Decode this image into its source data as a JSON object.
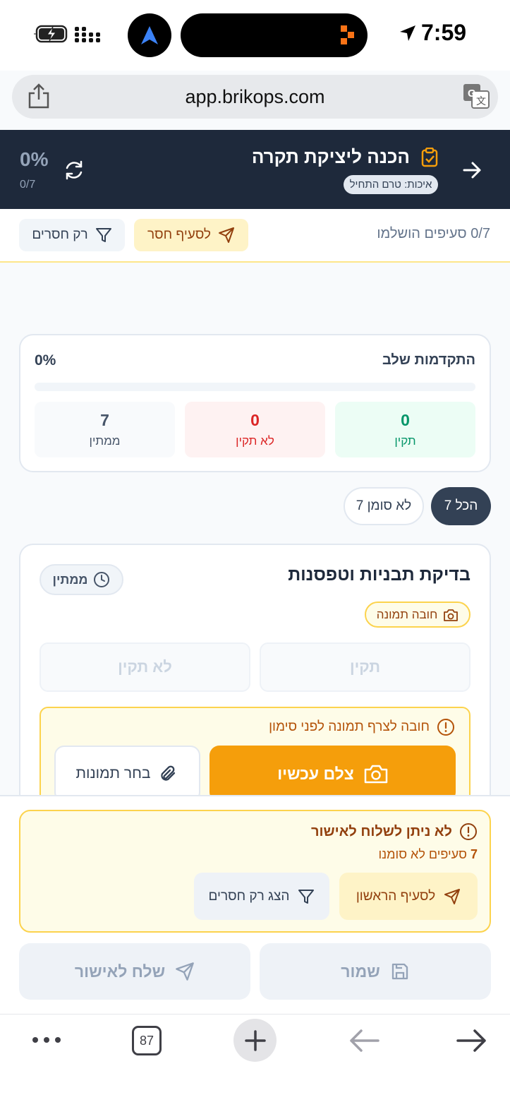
{
  "status_bar": {
    "time": "7:59"
  },
  "browser": {
    "url": "app.brikops.com",
    "tab_count": "87"
  },
  "header": {
    "title": "הכנה ליציקת תקרה",
    "badge": "איכות: טרם התחיל",
    "percent": "0%",
    "count": "0/7"
  },
  "toolbar": {
    "sections_done": "0/7 סעיפים הושלמו",
    "goto_missing_label": "לסעיף חסר",
    "only_missing_label": "רק חסרים"
  },
  "progress": {
    "title": "התקדמות שלב",
    "percent": "0%",
    "fill_fraction": 0,
    "stats": {
      "ok": {
        "value": "0",
        "label": "תקין"
      },
      "not_ok": {
        "value": "0",
        "label": "לא תקין"
      },
      "pending": {
        "value": "7",
        "label": "ממתין"
      }
    }
  },
  "filters": {
    "all": "הכל 7",
    "unmarked": "לא סומן 7"
  },
  "item": {
    "title": "בדיקת תבניות וטפסנות",
    "status": "ממתין",
    "photo_required": "חובה תמונה",
    "ok_label": "תקין",
    "not_ok_label": "לא תקין",
    "warning": "חובה לצרף תמונה לפני סימון",
    "camera_label": "צלם עכשיו",
    "pick_label": "בחר תמונות"
  },
  "bottom": {
    "cant_send_title": "לא ניתן לשלוח לאישור",
    "unmarked_count": "7",
    "unmarked_text": "סעיפים לא סומנו",
    "first_section_label": "לסעיף הראשון",
    "show_missing_label": "הצג רק חסרים",
    "save_label": "שמור",
    "send_label": "שלח לאישור"
  },
  "colors": {
    "header_bg": "#1e293b",
    "accent_amber": "#f59e0b",
    "ok_green": "#059669",
    "bad_red": "#dc2626"
  }
}
